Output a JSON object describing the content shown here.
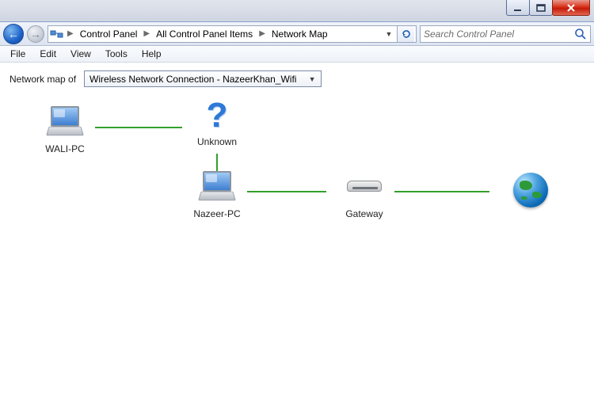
{
  "window": {
    "min_tip": "Minimize",
    "max_tip": "Maximize",
    "close_tip": "Close"
  },
  "breadcrumb": {
    "items": [
      "Control Panel",
      "All Control Panel Items",
      "Network Map"
    ]
  },
  "search": {
    "placeholder": "Search Control Panel"
  },
  "menu": {
    "file": "File",
    "edit": "Edit",
    "view": "View",
    "tools": "Tools",
    "help": "Help"
  },
  "map": {
    "label": "Network map of",
    "connection": "Wireless Network Connection - NazeerKhan_Wifi"
  },
  "nodes": {
    "wali": "WALI-PC",
    "unknown": "Unknown",
    "nazeer": "Nazeer-PC",
    "gateway": "Gateway",
    "internet": ""
  }
}
